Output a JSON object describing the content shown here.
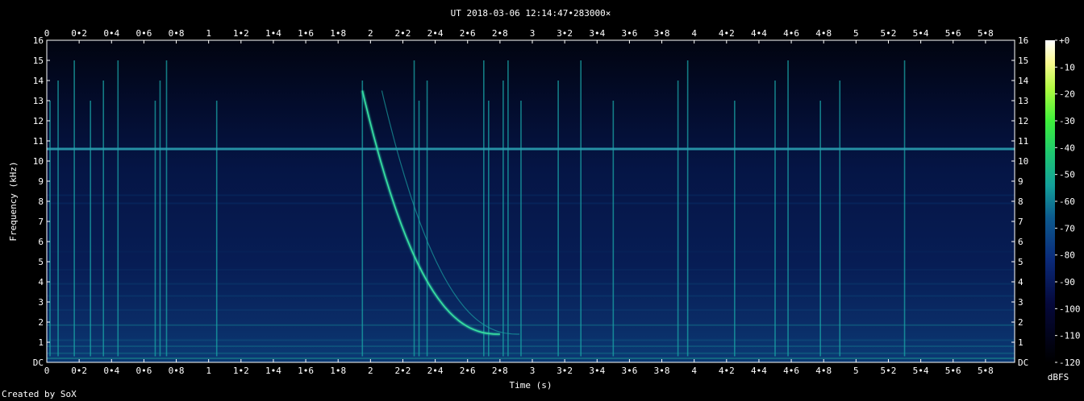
{
  "chart_data": {
    "type": "heatmap",
    "title": "UT 2018-03-06 12:14:47•283000×",
    "xlabel": "Time (s)",
    "ylabel": "Frequency (kHz)",
    "xlim": [
      0,
      5.98
    ],
    "ylim": [
      0,
      16
    ],
    "x_ticks": [
      "0",
      "0•2",
      "0•4",
      "0•6",
      "0•8",
      "1",
      "1•2",
      "1•4",
      "1•6",
      "1•8",
      "2",
      "2•2",
      "2•4",
      "2•6",
      "2•8",
      "3",
      "3•2",
      "3•4",
      "3•6",
      "3•8",
      "4",
      "4•2",
      "4•4",
      "4•6",
      "4•8",
      "5",
      "5•2",
      "5•4",
      "5•6",
      "5•8"
    ],
    "y_ticks": [
      "DC",
      "1",
      "2",
      "3",
      "4",
      "5",
      "6",
      "7",
      "8",
      "9",
      "10",
      "11",
      "12",
      "13",
      "14",
      "15",
      "16"
    ],
    "colorbar": {
      "label": "dBFS",
      "ticks": [
        "+0",
        "-10",
        "-20",
        "-30",
        "-40",
        "-50",
        "-60",
        "-70",
        "-80",
        "-90",
        "-100",
        "-110",
        "-120"
      ],
      "range": [
        -120,
        0
      ]
    },
    "features": {
      "steady_tone_khz": 10.6,
      "whistler": {
        "start_time_s": 1.95,
        "start_freq_khz": 13.5,
        "end_time_s": 2.8,
        "end_freq_khz": 1.4
      },
      "sferic_times_s": [
        0.02,
        0.07,
        0.17,
        0.27,
        0.35,
        0.44,
        0.67,
        0.7,
        0.74,
        1.05,
        1.95,
        2.27,
        2.3,
        2.35,
        2.7,
        2.73,
        2.82,
        2.85,
        2.93,
        3.16,
        3.3,
        3.5,
        3.9,
        3.96,
        4.25,
        4.5,
        4.58,
        4.78,
        4.9,
        5.3
      ]
    },
    "grid": false
  },
  "footer_text": "Created by SoX"
}
